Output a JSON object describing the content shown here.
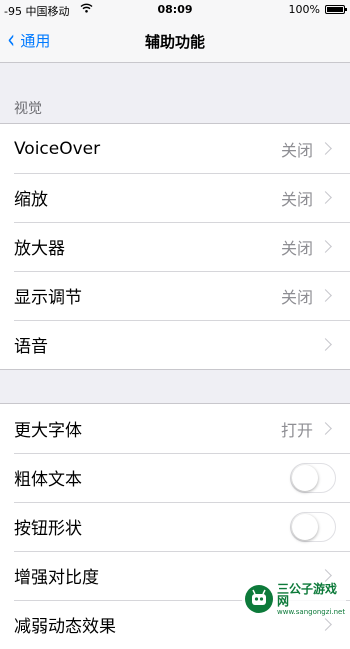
{
  "status_bar": {
    "carrier": "-95 中国移动",
    "time": "08:09",
    "battery": "100%"
  },
  "nav": {
    "back_label": "通用",
    "title": "辅助功能"
  },
  "section_visual": {
    "header": "视觉",
    "items": [
      {
        "label": "VoiceOver",
        "value": "关闭"
      },
      {
        "label": "缩放",
        "value": "关闭"
      },
      {
        "label": "放大器",
        "value": "关闭"
      },
      {
        "label": "显示调节",
        "value": "关闭"
      },
      {
        "label": "语音",
        "value": ""
      }
    ]
  },
  "section_text": {
    "items": [
      {
        "label": "更大字体",
        "value": "打开"
      },
      {
        "label": "粗体文本",
        "toggle": "off"
      },
      {
        "label": "按钮形状",
        "toggle": "off"
      },
      {
        "label": "增强对比度",
        "value": ""
      },
      {
        "label": "减弱动态效果",
        "value": ""
      }
    ]
  },
  "watermark": {
    "name": "三公子游戏网",
    "url": "www.sangongzi.net"
  }
}
